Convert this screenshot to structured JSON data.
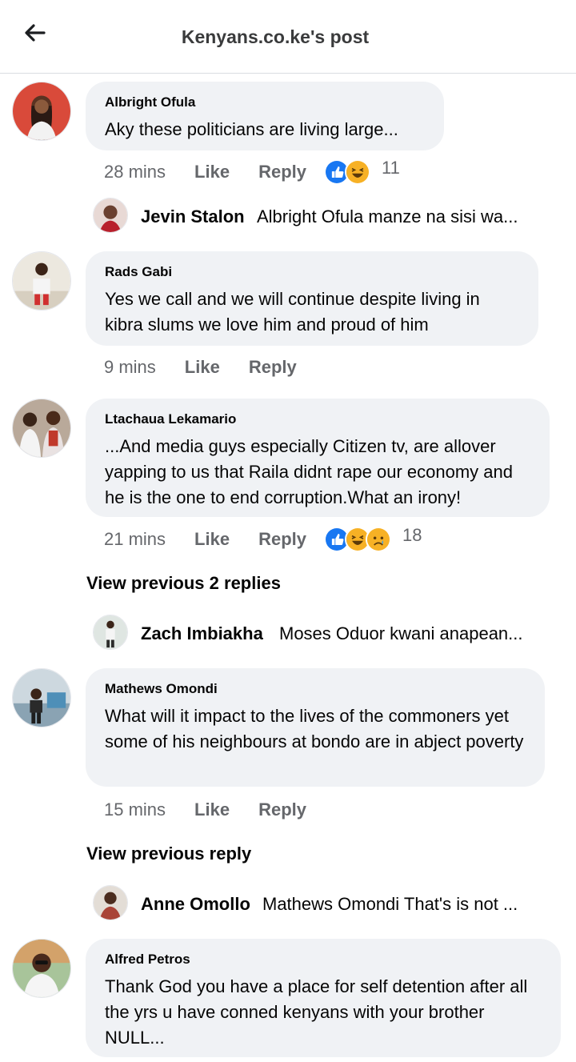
{
  "header": {
    "title": "Kenyans.co.ke's post",
    "back_icon": "arrow-left-icon"
  },
  "actions": {
    "like": "Like",
    "reply": "Reply"
  },
  "colors": {
    "bubble": "#f0f2f5",
    "meta_text": "#65676b",
    "like_blue": "#1877f2",
    "haha_yellow": "#f7b125"
  },
  "comments": [
    {
      "author": "Albright Ofula",
      "text": "Aky these politicians are living large...",
      "time": "28 mins",
      "reactions": [
        "like",
        "haha"
      ],
      "reaction_count": "11"
    },
    {
      "author": "Rads Gabi",
      "text": "Yes we call and we will continue despite living in kibra slums we love him and proud of him",
      "time": "9 mins"
    },
    {
      "author": "Ltachaua Lekamario",
      "text": "...And media guys especially Citizen tv, are allover yapping to us that Raila didnt rape our economy and he is the one to end corruption.What an irony!",
      "time": "21 mins",
      "reactions": [
        "like",
        "haha",
        "sad"
      ],
      "reaction_count": "18"
    },
    {
      "author": "Mathews Omondi",
      "text": "What will it impact to the lives of the commoners yet some of his neighbours at bondo are in abject poverty",
      "time": "15 mins"
    },
    {
      "author": "Alfred Petros",
      "text": "Thank God you have a place for self detention after all the yrs u have conned kenyans with your brother NULL..."
    }
  ],
  "replies": [
    {
      "author": "Jevin Stalon",
      "text": "Albright Ofula manze na sisi wa..."
    },
    {
      "author": "Zach Imbiakha",
      "text": "Moses Oduor kwani anapean..."
    },
    {
      "author": "Anne Omollo",
      "text": "Mathews Omondi That's is not ..."
    }
  ],
  "view_previous": [
    "View previous 2 replies",
    "View previous reply"
  ]
}
